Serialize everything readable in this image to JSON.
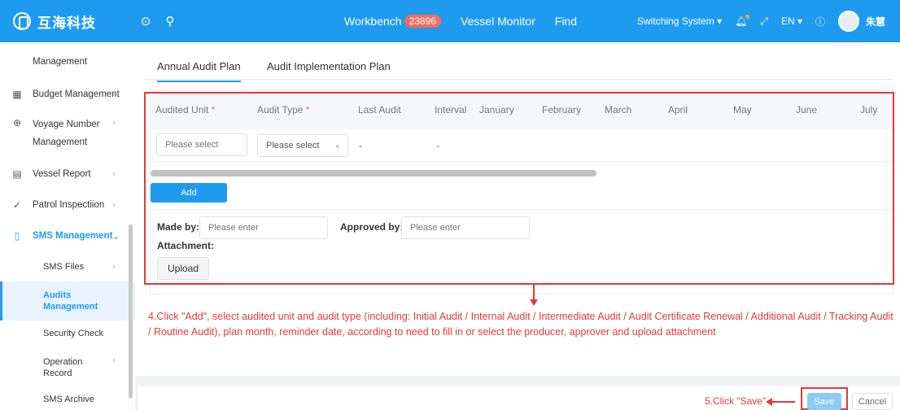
{
  "header": {
    "logo_text": "互海科技",
    "nav": {
      "workbench": "Workbench",
      "workbench_badge": "23896",
      "vessel_monitor": "Vessel Monitor",
      "find": "Find"
    },
    "switching_system": "Switching System ▾",
    "language": "EN ▾",
    "user_name": "朱慧"
  },
  "sidebar": {
    "items": [
      {
        "label": "Management"
      },
      {
        "label": "Budget Management"
      },
      {
        "label": "Voyage Number",
        "label2": "Management"
      },
      {
        "label": "Vessel Report"
      },
      {
        "label": "Patrol Inspectiion"
      },
      {
        "label": "SMS Management"
      },
      {
        "label": "SMS Files"
      },
      {
        "label": "Audits",
        "label2": "Management"
      },
      {
        "label": "Security Check"
      },
      {
        "label": "Operation",
        "label2": "Record"
      },
      {
        "label": "SMS Archive"
      }
    ]
  },
  "tabs": [
    {
      "label": "Annual Audit Plan"
    },
    {
      "label": "Audit Implementation Plan"
    }
  ],
  "table": {
    "columns": [
      "Audited Unit",
      "Audit Type",
      "Last Audit",
      "Interval",
      "January",
      "February",
      "March",
      "April",
      "May",
      "June",
      "July"
    ],
    "required_mark": "*",
    "row": {
      "unit_placeholder": "Please select",
      "type_value": "Please select",
      "last_audit": "-",
      "interval": "-"
    }
  },
  "add_button": "Add",
  "form": {
    "made_by_label": "Made by:",
    "made_by_placeholder": "Please enter",
    "approved_by_label": "Approved by:",
    "approved_by_placeholder": "Please enter",
    "attachment_label": "Attachment:",
    "upload_button": "Upload"
  },
  "annotation": {
    "step4": "4.Click \"Add\", select audited unit and audit type (including: Initial Audit / Internal Audit / Intermediate Audit / Audit Certificate Renewal / Additional Audit / Tracking Audit / Routine Audit), plan month, reminder date, according to need to fill in or select the producer, approver and upload attachment",
    "step5": "5.Click \"Save\""
  },
  "footer": {
    "save": "Save",
    "cancel": "Cancel"
  },
  "colors": {
    "primary": "#1e9bef",
    "annotation": "#e03a3a",
    "badge": "#f56c5f"
  }
}
